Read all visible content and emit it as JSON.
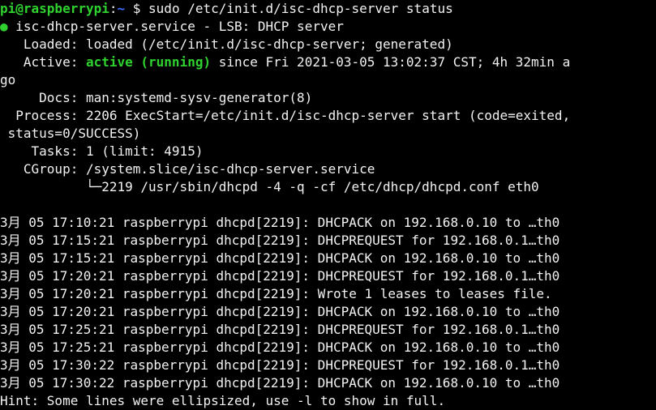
{
  "prompt": {
    "user_host": "pi@raspberrypi",
    "separator": ":",
    "path": "~",
    "symbol": " $",
    "command": " sudo /etc/init.d/isc-dhcp-server status"
  },
  "status": {
    "dot": "●",
    "service_line": " isc-dhcp-server.service - LSB: DHCP server",
    "loaded_line": "   Loaded: loaded (/etc/init.d/isc-dhcp-server; generated)",
    "active_label": "   Active: ",
    "active_state": "active (running)",
    "active_since": " since Fri 2021-03-05 13:02:37 CST; 4h 32min a",
    "active_wrap": "go",
    "docs_line": "     Docs: man:systemd-sysv-generator(8)",
    "process_line": "  Process: 2206 ExecStart=/etc/init.d/isc-dhcp-server start (code=exited,",
    "process_wrap": " status=0/SUCCESS)",
    "tasks_line": "    Tasks: 1 (limit: 4915)",
    "cgroup_line": "   CGroup: /system.slice/isc-dhcp-server.service",
    "cgroup_child": "           └─2219 /usr/sbin/dhcpd -4 -q -cf /etc/dhcp/dhcpd.conf eth0"
  },
  "log_lines": [
    "3月 05 17:10:21 raspberrypi dhcpd[2219]: DHCPACK on 192.168.0.10 to …th0",
    "3月 05 17:15:21 raspberrypi dhcpd[2219]: DHCPREQUEST for 192.168.0.1…th0",
    "3月 05 17:15:21 raspberrypi dhcpd[2219]: DHCPACK on 192.168.0.10 to …th0",
    "3月 05 17:20:21 raspberrypi dhcpd[2219]: DHCPREQUEST for 192.168.0.1…th0",
    "3月 05 17:20:21 raspberrypi dhcpd[2219]: Wrote 1 leases to leases file.",
    "3月 05 17:20:21 raspberrypi dhcpd[2219]: DHCPACK on 192.168.0.10 to …th0",
    "3月 05 17:25:21 raspberrypi dhcpd[2219]: DHCPREQUEST for 192.168.0.1…th0",
    "3月 05 17:25:21 raspberrypi dhcpd[2219]: DHCPACK on 192.168.0.10 to …th0",
    "3月 05 17:30:22 raspberrypi dhcpd[2219]: DHCPREQUEST for 192.168.0.1…th0",
    "3月 05 17:30:22 raspberrypi dhcpd[2219]: DHCPACK on 192.168.0.10 to …th0"
  ],
  "hint": "Hint: Some lines were ellipsized, use -l to show in full.",
  "colors": {
    "background": "#000000",
    "foreground": "#f2f2f2",
    "green": "#2fd22f",
    "blue": "#3b6bff"
  }
}
